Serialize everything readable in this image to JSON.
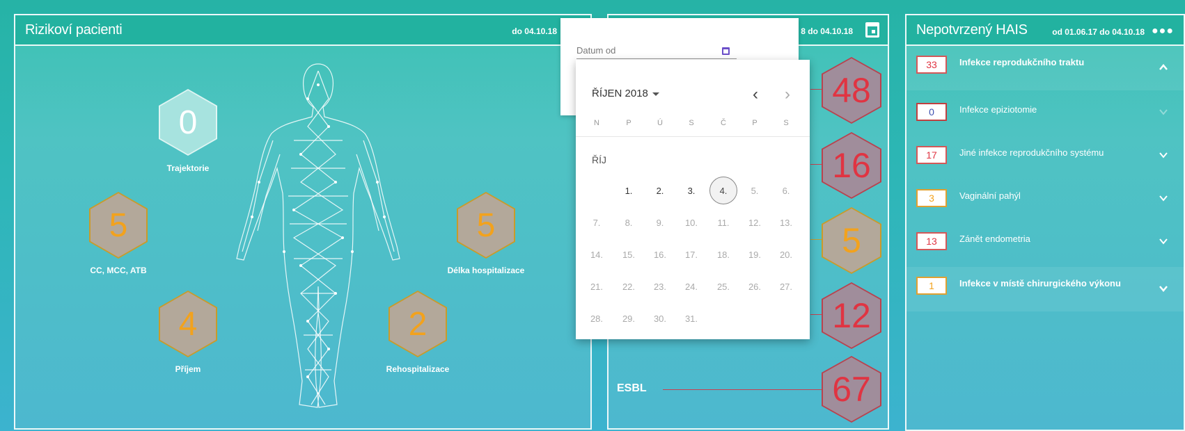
{
  "panel1": {
    "title": "Rizikoví pacienti",
    "date": "do 04.10.18",
    "hexes": [
      {
        "id": "trajektorie",
        "value": "0",
        "label": "Trajektorie"
      },
      {
        "id": "cc",
        "value": "5",
        "label": "CC, MCC, ATB"
      },
      {
        "id": "delka",
        "value": "5",
        "label": "Délka hospitalizace"
      },
      {
        "id": "prijem",
        "value": "4",
        "label": "Příjem"
      },
      {
        "id": "rehosp",
        "value": "2",
        "label": "Rehospitalizace"
      }
    ]
  },
  "panel2": {
    "date_partial": "8 do 04.10.18",
    "values": [
      "48",
      "16",
      "5",
      "12",
      "67"
    ],
    "esbl_label": "ESBL"
  },
  "panel3": {
    "title": "Nepotvrzený HAIS",
    "date": "od 01.06.17 do 04.10.18",
    "menu_dots": "●●●",
    "rows": [
      {
        "count": "33",
        "name": "Infekce reprodukčního traktu",
        "count_color": "#e03442",
        "border": "#d45858"
      },
      {
        "count": "0",
        "name": "Infekce epiziotomie",
        "count_color": "#3b4fb0",
        "border": "#c04040"
      },
      {
        "count": "17",
        "name": "Jiné infekce reprodukčního systému",
        "count_color": "#e03442",
        "border": "#d45858"
      },
      {
        "count": "3",
        "name": "Vaginální pahýl",
        "count_color": "#f2a21d",
        "border": "#e0a030"
      },
      {
        "count": "13",
        "name": "Zánět endometria",
        "count_color": "#e03442",
        "border": "#d45858"
      },
      {
        "count": "1",
        "name": "Infekce v místě chirurgického výkonu",
        "count_color": "#f2a21d",
        "border": "#e0a030"
      }
    ]
  },
  "datepicker": {
    "input_label": "Datum od",
    "month_title": "ŘÍJEN 2018",
    "month_label": "ŘÍJ",
    "weekday_headers": [
      "N",
      "P",
      "Ú",
      "S",
      "Č",
      "P",
      "S"
    ],
    "weeks": [
      [
        "",
        "1.",
        "2.",
        "3.",
        "4.",
        "5.",
        "6."
      ],
      [
        "7.",
        "8.",
        "9.",
        "10.",
        "11.",
        "12.",
        "13."
      ],
      [
        "14.",
        "15.",
        "16.",
        "17.",
        "18.",
        "19.",
        "20."
      ],
      [
        "21.",
        "22.",
        "23.",
        "24.",
        "25.",
        "26.",
        "27."
      ],
      [
        "28.",
        "29.",
        "30.",
        "31.",
        "",
        "",
        ""
      ]
    ],
    "today": "4."
  },
  "colors": {
    "accent_orange": "#f2a21d",
    "accent_red": "#e03442",
    "header_teal": "#22b2a0"
  }
}
